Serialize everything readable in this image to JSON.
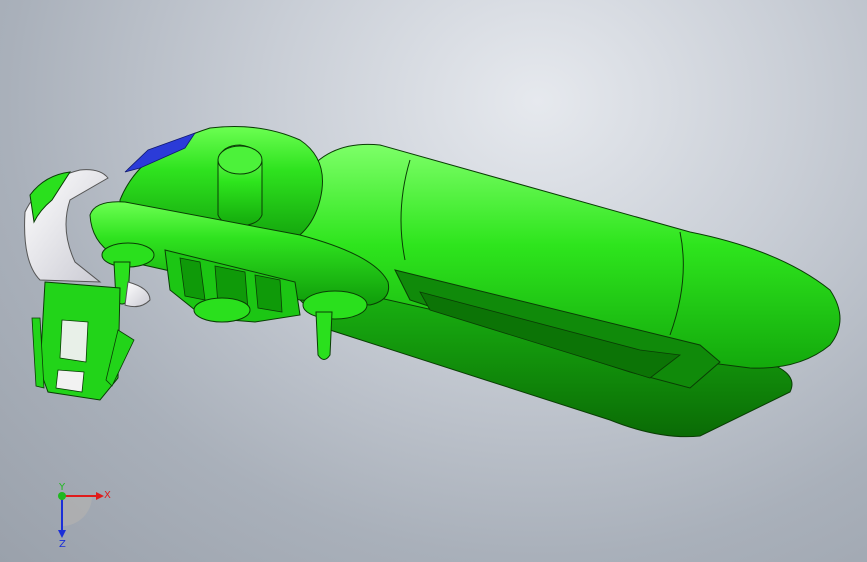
{
  "triad": {
    "x_label": "X",
    "y_label": "Y",
    "z_label": "Z"
  },
  "colors": {
    "background_light": "#e6e9ee",
    "background_dark": "#9aa1ab",
    "part_green": "#22e01a",
    "part_green_dark": "#0b7a06",
    "edge": "#0a3d05",
    "cap_white": "#eeeeef",
    "blue_trim": "#2b3bd8",
    "axis_x": "#e01b1b",
    "axis_y": "#1fb81f",
    "axis_z": "#1b2fd8"
  },
  "icons": {
    "triad": "coordinate-triad-icon"
  }
}
